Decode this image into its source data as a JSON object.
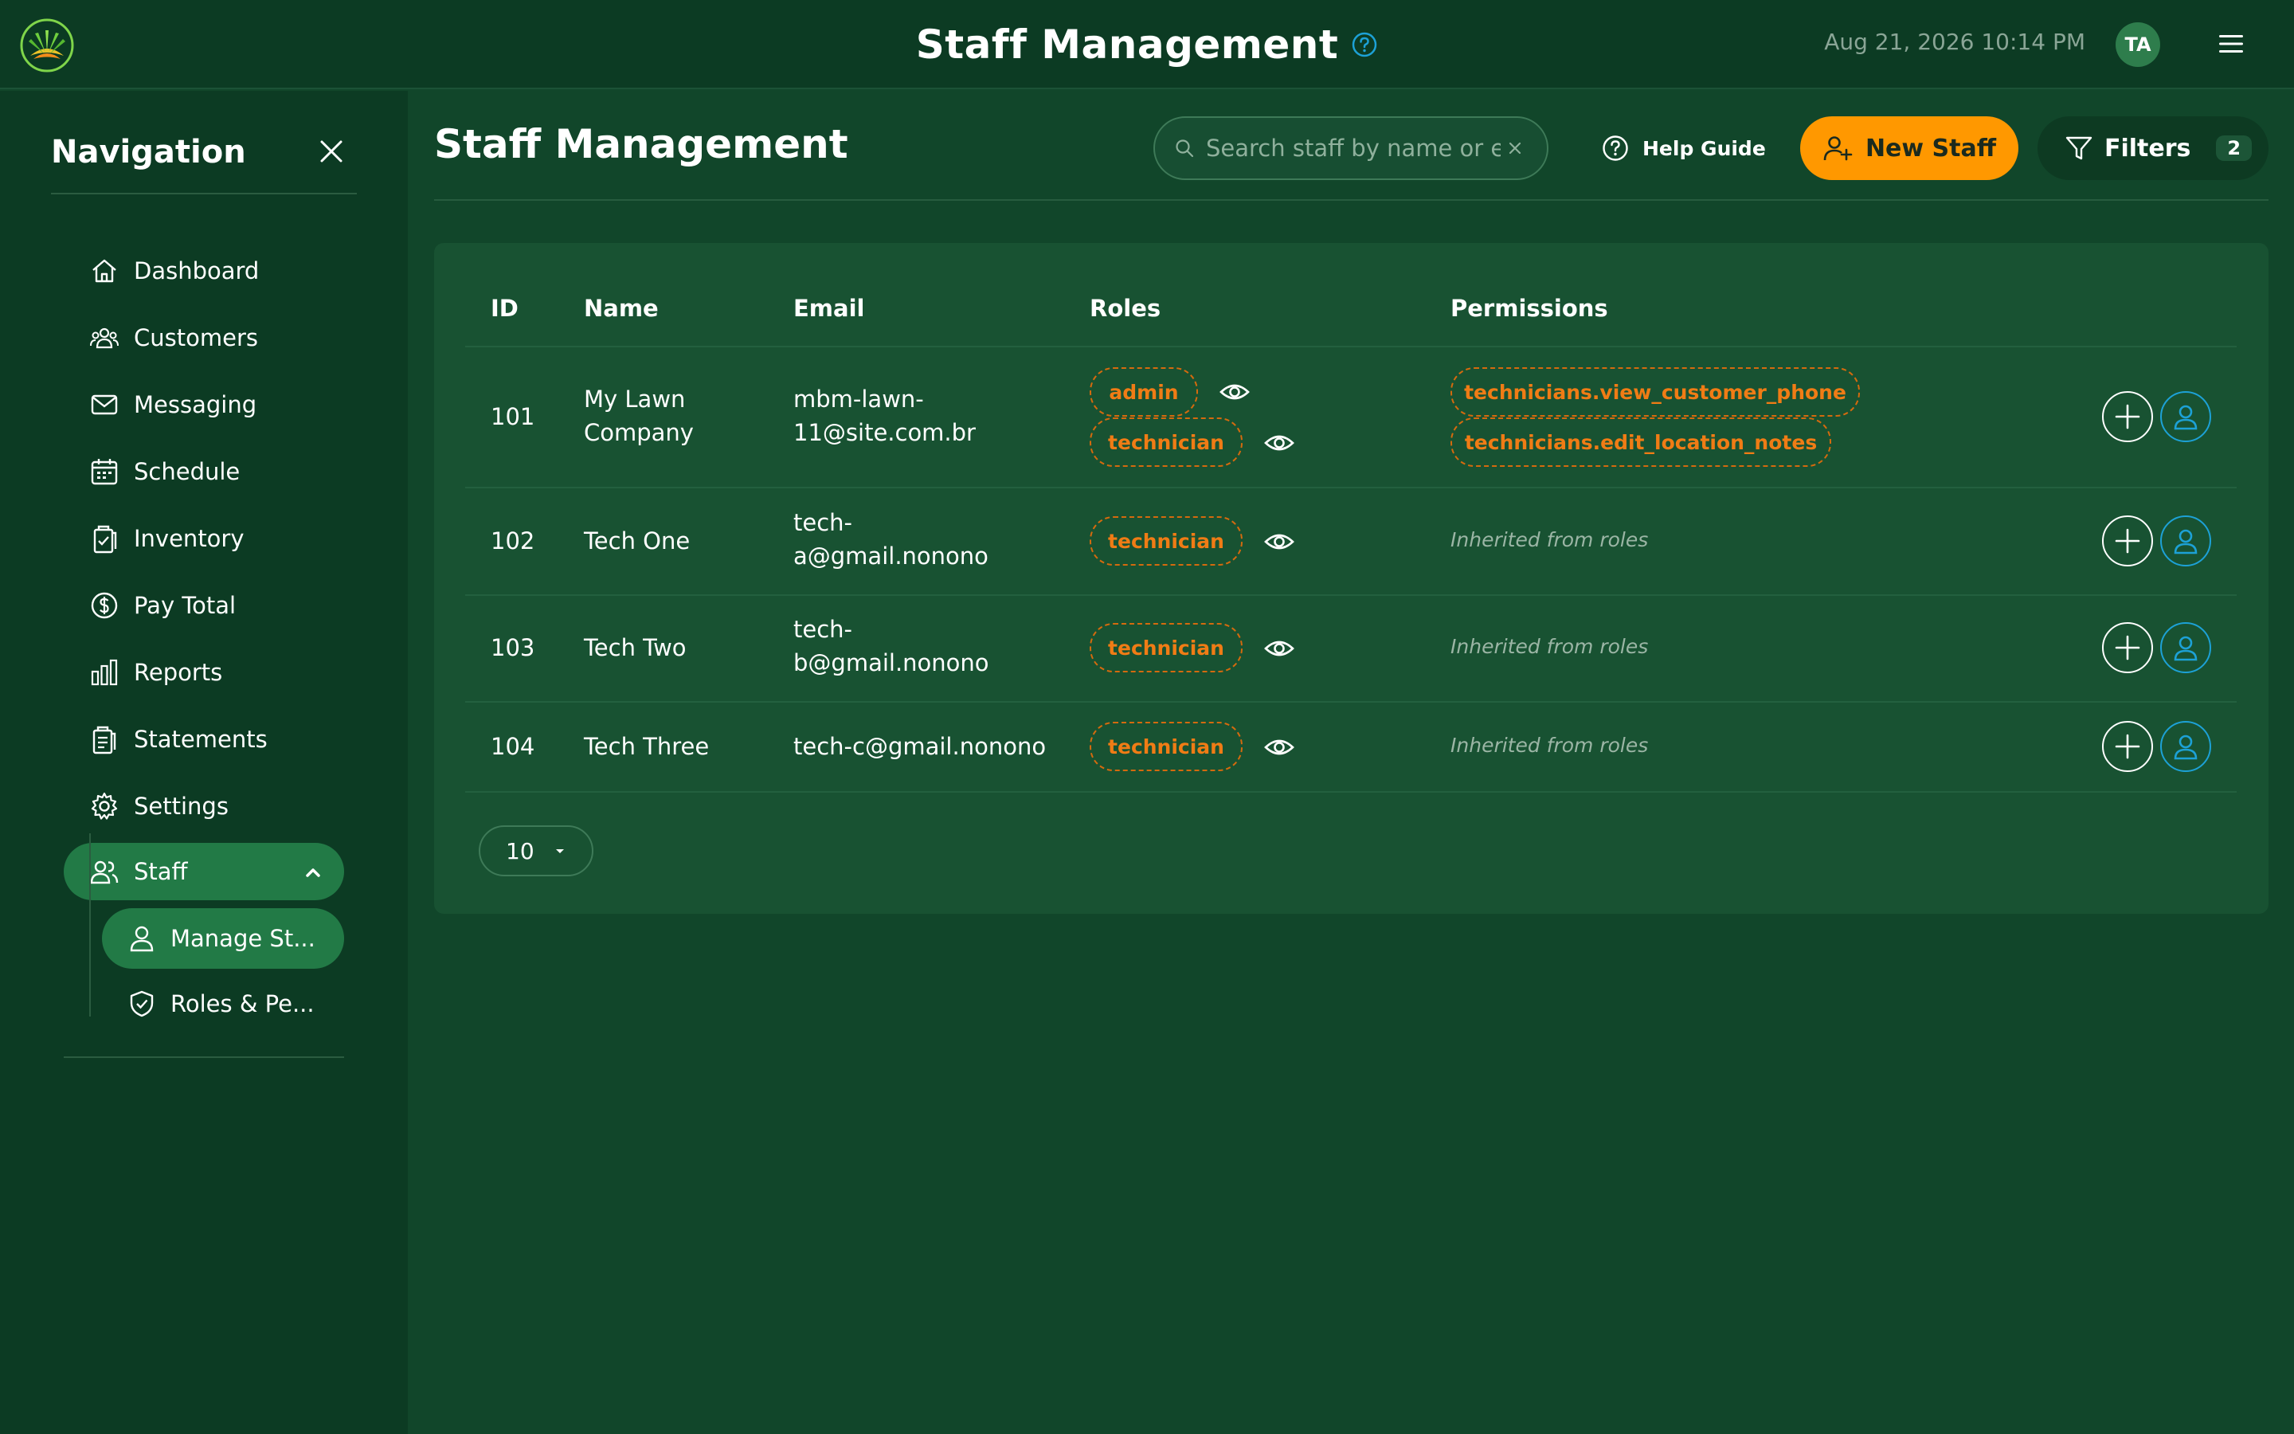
{
  "header": {
    "title": "Staff Management",
    "datetime": "Aug 21, 2026 10:14 PM",
    "avatar_initials": "TA"
  },
  "sidebar": {
    "title": "Navigation",
    "items": [
      {
        "label": "Dashboard",
        "icon": "home-icon"
      },
      {
        "label": "Customers",
        "icon": "users-group-icon"
      },
      {
        "label": "Messaging",
        "icon": "mail-icon"
      },
      {
        "label": "Schedule",
        "icon": "calendar-icon"
      },
      {
        "label": "Inventory",
        "icon": "clipboard-check-icon"
      },
      {
        "label": "Pay Total",
        "icon": "dollar-circle-icon"
      },
      {
        "label": "Reports",
        "icon": "bar-chart-icon"
      },
      {
        "label": "Statements",
        "icon": "document-list-icon"
      },
      {
        "label": "Settings",
        "icon": "gear-icon"
      },
      {
        "label": "Staff",
        "icon": "users-icon",
        "expanded": true
      }
    ],
    "sub_items": [
      {
        "label": "Manage St...",
        "icon": "user-icon",
        "active": true
      },
      {
        "label": "Roles & Pe...",
        "icon": "shield-check-icon"
      }
    ]
  },
  "main": {
    "title": "Staff Management",
    "search_placeholder": "Search staff by name or email",
    "help_guide_label": "Help Guide",
    "new_staff_label": "New Staff",
    "filters_label": "Filters",
    "filters_count": "2",
    "columns": [
      "ID",
      "Name",
      "Email",
      "Roles",
      "Permissions"
    ],
    "rows": [
      {
        "id": "101",
        "name_lines": [
          "My Lawn",
          "Company"
        ],
        "email_lines": [
          "mbm-lawn-",
          "11@site.com.br"
        ],
        "roles": [
          "admin",
          "technician"
        ],
        "permissions": [
          "technicians.view_customer_phone",
          "technicians.edit_location_notes"
        ]
      },
      {
        "id": "102",
        "name_lines": [
          "Tech One"
        ],
        "email_lines": [
          "tech-",
          "a@gmail.nonono"
        ],
        "roles": [
          "technician"
        ],
        "permissions_text": "Inherited from roles"
      },
      {
        "id": "103",
        "name_lines": [
          "Tech Two"
        ],
        "email_lines": [
          "tech-",
          "b@gmail.nonono"
        ],
        "roles": [
          "technician"
        ],
        "permissions_text": "Inherited from roles"
      },
      {
        "id": "104",
        "name_lines": [
          "Tech Three"
        ],
        "email_lines": [
          "tech-c@gmail.nonono"
        ],
        "roles": [
          "technician"
        ],
        "permissions_text": "Inherited from roles"
      }
    ],
    "page_size": "10"
  },
  "colors": {
    "background": "#11462a",
    "sidebar": "#0c3b23",
    "accent_orange": "#ff9800",
    "active_green": "#227a46",
    "info_blue": "#1da1d6"
  }
}
